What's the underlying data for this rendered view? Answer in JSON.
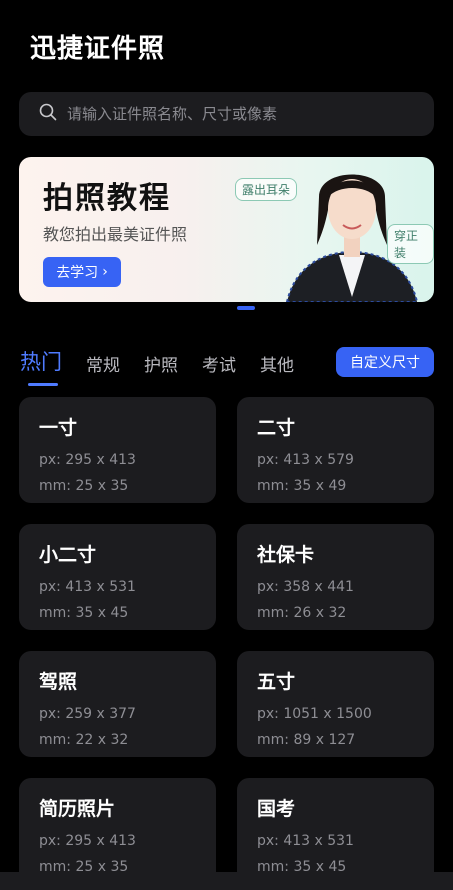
{
  "app": {
    "title": "迅捷证件照"
  },
  "search": {
    "placeholder": "请输入证件照名称、尺寸或像素"
  },
  "banner": {
    "title": "拍照教程",
    "subtitle": "教您拍出最美证件照",
    "button_label": "去学习",
    "tag_ear": "露出耳朵",
    "tag_suit": "穿正装"
  },
  "tabs": [
    {
      "label": "热门",
      "active": true
    },
    {
      "label": "常规"
    },
    {
      "label": "护照"
    },
    {
      "label": "考试"
    },
    {
      "label": "其他"
    }
  ],
  "custom_size_label": "自定义尺寸",
  "cards": [
    {
      "name": "一寸",
      "px": "px: 295 x 413",
      "mm": "mm: 25 x 35"
    },
    {
      "name": "二寸",
      "px": "px: 413 x 579",
      "mm": "mm: 35 x 49"
    },
    {
      "name": "小二寸",
      "px": "px: 413 x 531",
      "mm": "mm: 35 x 45"
    },
    {
      "name": "社保卡",
      "px": "px: 358 x 441",
      "mm": "mm: 26 x 32"
    },
    {
      "name": "驾照",
      "px": "px: 259 x 377",
      "mm": "mm: 22 x 32"
    },
    {
      "name": "五寸",
      "px": "px: 1051 x 1500",
      "mm": "mm: 89 x 127"
    },
    {
      "name": "简历照片",
      "px": "px: 295 x 413",
      "mm": "mm: 25 x 35"
    },
    {
      "name": "国考",
      "px": "px: 413 x 531",
      "mm": "mm: 35 x 45"
    }
  ],
  "colors": {
    "accent": "#3763f4",
    "card_bg": "#1c1c1f",
    "background": "#000000"
  }
}
